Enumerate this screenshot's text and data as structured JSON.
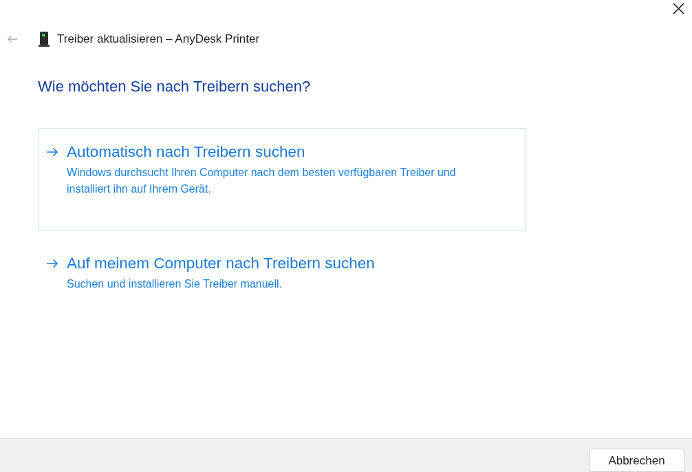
{
  "window": {
    "title": "Treiber aktualisieren – AnyDesk Printer"
  },
  "back": {
    "disabled": true
  },
  "heading": "Wie möchten Sie nach Treibern suchen?",
  "options": [
    {
      "title": "Automatisch nach Treibern suchen",
      "description": "Windows durchsucht Ihren Computer nach dem besten verfügbaren Treiber und installiert ihn auf Ihrem Gerät.",
      "selected": true
    },
    {
      "title": "Auf meinem Computer nach Treibern suchen",
      "description": "Suchen und installieren Sie Treiber manuell.",
      "selected": false
    }
  ],
  "buttons": [
    {
      "label": "Abbrechen"
    }
  ]
}
